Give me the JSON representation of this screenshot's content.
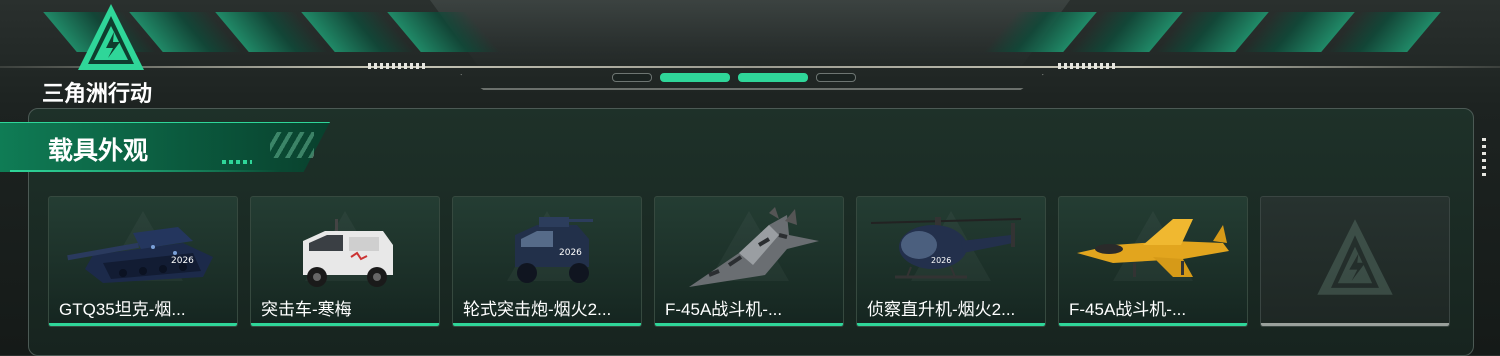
{
  "brand": {
    "name": "三角洲行动"
  },
  "section": {
    "title": "载具外观"
  },
  "vehicles": [
    {
      "label": "GTQ35坦克-烟...",
      "icon": "tank-icon"
    },
    {
      "label": "突击车-寒梅",
      "icon": "assault-vehicle-icon"
    },
    {
      "label": "轮式突击炮-烟火2...",
      "icon": "wheeled-gun-icon"
    },
    {
      "label": "F-45A战斗机-...",
      "icon": "fighter-jet-icon"
    },
    {
      "label": "侦察直升机-烟火2...",
      "icon": "helicopter-icon"
    },
    {
      "label": "F-45A战斗机-...",
      "icon": "fighter-jet-yellow-icon"
    },
    {
      "label": "",
      "icon": "empty-slot-icon"
    }
  ],
  "colors": {
    "accent": "#2fd699",
    "panel": "#1e3129"
  }
}
